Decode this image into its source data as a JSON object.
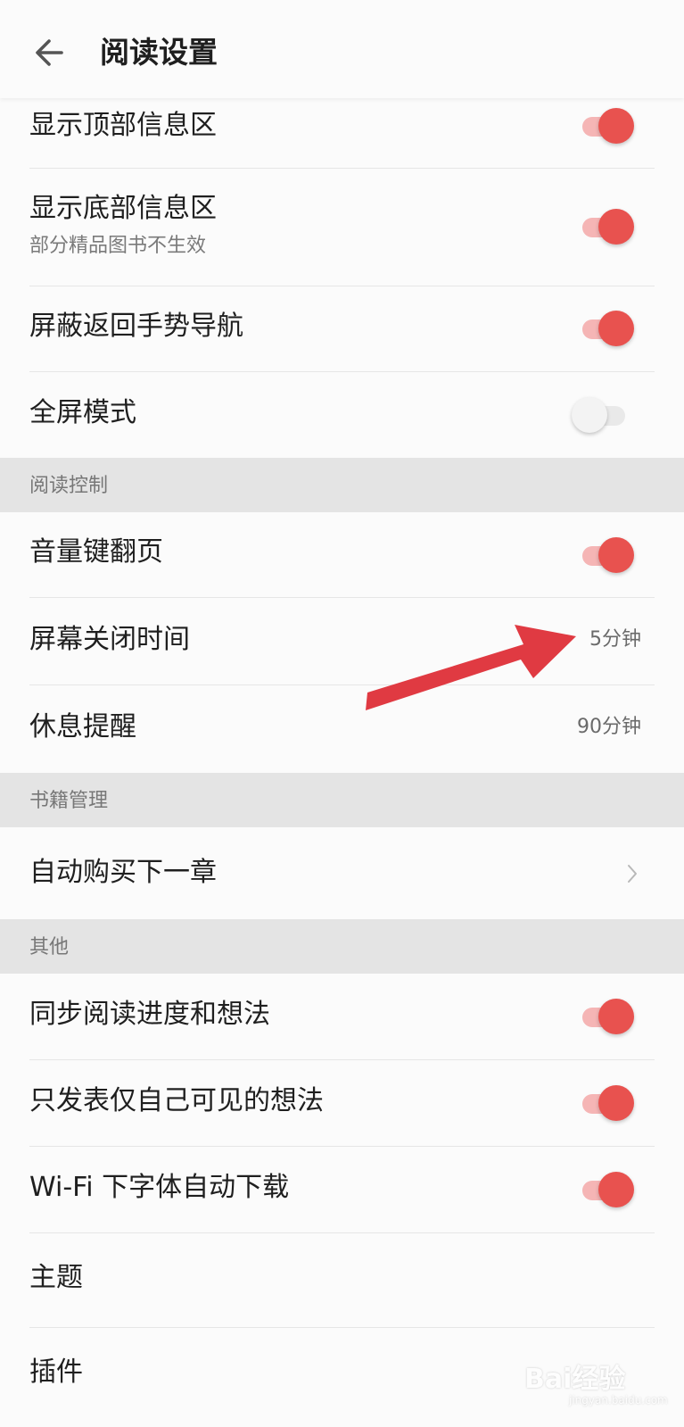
{
  "header": {
    "title": "阅读设置",
    "back_icon": "arrow-left-icon"
  },
  "rows": [
    {
      "label": "显示顶部信息区",
      "toggle": true
    },
    {
      "label": "显示底部信息区",
      "sublabel": "部分精品图书不生效",
      "toggle": true
    },
    {
      "label": "屏蔽返回手势导航",
      "toggle": true
    },
    {
      "label": "全屏模式",
      "toggle": false
    },
    {
      "label": "音量键翻页",
      "toggle": true
    },
    {
      "label": "屏幕关闭时间",
      "value": "5分钟"
    },
    {
      "label": "休息提醒",
      "value": "90分钟"
    },
    {
      "label": "自动购买下一章",
      "icon": "chevron-right-icon"
    },
    {
      "label": "同步阅读进度和想法",
      "toggle": true
    },
    {
      "label": "只发表仅自己可见的想法",
      "toggle": true
    },
    {
      "label": "Wi-Fi 下字体自动下载",
      "toggle": true
    },
    {
      "label": "主题"
    },
    {
      "label": "插件"
    }
  ],
  "sections": [
    {
      "label": "阅读控制"
    },
    {
      "label": "书籍管理"
    },
    {
      "label": "其他"
    }
  ],
  "colors": {
    "accent": "#e8524f",
    "accent_track": "#f5b5b5",
    "section_bg": "#e4e4e4",
    "annotation_arrow": "#e03a42"
  },
  "watermark": {
    "text": "Bai经验",
    "url_text": "jingyan.baidu.com"
  }
}
